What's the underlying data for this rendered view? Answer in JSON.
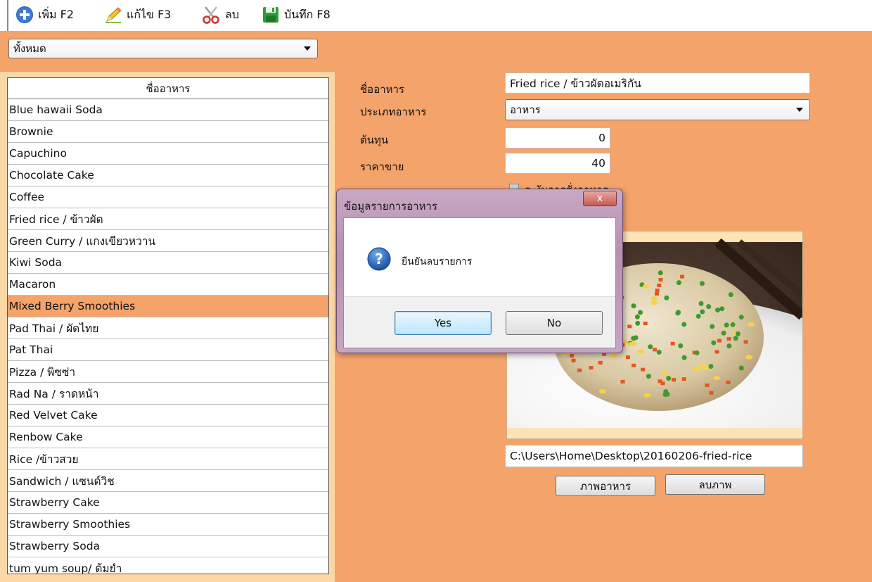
{
  "toolbar": {
    "add_label": "เพิ่ม F2",
    "edit_label": "แก้ไข F3",
    "delete_label": "ลบ",
    "save_label": "บันทึก F8"
  },
  "left": {
    "filter_value": "ทั้งหมด",
    "list_header": "ชื่ออาหาร",
    "items": [
      "Blue hawaii Soda",
      "Brownie",
      "Capuchino",
      "Chocolate Cake",
      "Coffee",
      "Fried rice / ข้าวผัด",
      "Green Curry / แกงเขียวหวาน",
      "Kiwi Soda",
      "Macaron",
      "Mixed Berry Smoothies",
      "Pad Thai / ผัดไทย",
      "Pat Thai",
      "Pizza / พิซซ่า",
      "Rad Na / ราดหน้า",
      "Red Velvet Cake",
      "Renbow Cake",
      "Rice /ข้าวสวย",
      "Sandwich / แซนด์วิช",
      "Strawberry Cake",
      "Strawberry Smoothies",
      "Strawberry Soda",
      "tum yum soup/ ต้มยำ"
    ],
    "selected_index": 9
  },
  "form": {
    "name_label": "ชื่ออาหาร",
    "name_value": "Fried rice / ข้าวผัดอเมริกัน",
    "type_label": "ประเภทอาหาร",
    "type_value": "อาหาร",
    "cost_label": "ต้นทุน",
    "cost_value": "0",
    "price_label": "ราคาขาย",
    "price_value": "40",
    "checkbox_label": "ระงับการสั่งอาหาร",
    "image_path": "C:\\Users\\Home\\Desktop\\20160206-fried-rice",
    "image_button": "ภาพอาหาร",
    "remove_image_button": "ลบภาพ"
  },
  "dialog": {
    "title": "ข้อมูลรายการอาหาร",
    "close": "x",
    "message": "ยืนยันลบรายการ",
    "yes": "Yes",
    "no": "No"
  },
  "colors": {
    "panel_orange": "#f4a36a",
    "list_background": "#fbd7a6"
  }
}
